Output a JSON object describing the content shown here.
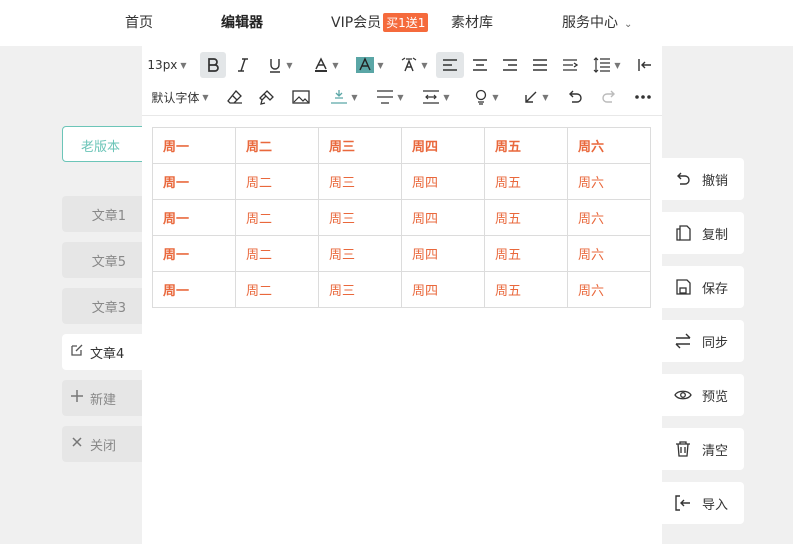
{
  "nav": {
    "home": "首页",
    "editor": "编辑器",
    "vip": "VIP会员",
    "vip_badge": "买1送1",
    "material": "素材库",
    "service": "服务中心"
  },
  "sidebar": {
    "old_version": "老版本",
    "articles": [
      "文章1",
      "文章5",
      "文章3"
    ],
    "current_article": "文章4",
    "new_label": "新建",
    "close_label": "关闭"
  },
  "toolbar": {
    "font_size": "13px",
    "font_family": "默认字体"
  },
  "table": {
    "rows": [
      [
        "周一",
        "周二",
        "周三",
        "周四",
        "周五",
        "周六"
      ],
      [
        "周一",
        "周二",
        "周三",
        "周四",
        "周五",
        "周六"
      ],
      [
        "周一",
        "周二",
        "周三",
        "周四",
        "周五",
        "周六"
      ],
      [
        "周一",
        "周二",
        "周三",
        "周四",
        "周五",
        "周六"
      ],
      [
        "周一",
        "周二",
        "周三",
        "周四",
        "周五",
        "周六"
      ]
    ],
    "text_color": "#e9683c"
  },
  "actions": {
    "undo": "撤销",
    "copy": "复制",
    "save": "保存",
    "sync": "同步",
    "preview": "预览",
    "clear": "清空",
    "import": "导入"
  },
  "colors": {
    "accent": "#6cc5b8",
    "badge": "#f56a3c"
  }
}
